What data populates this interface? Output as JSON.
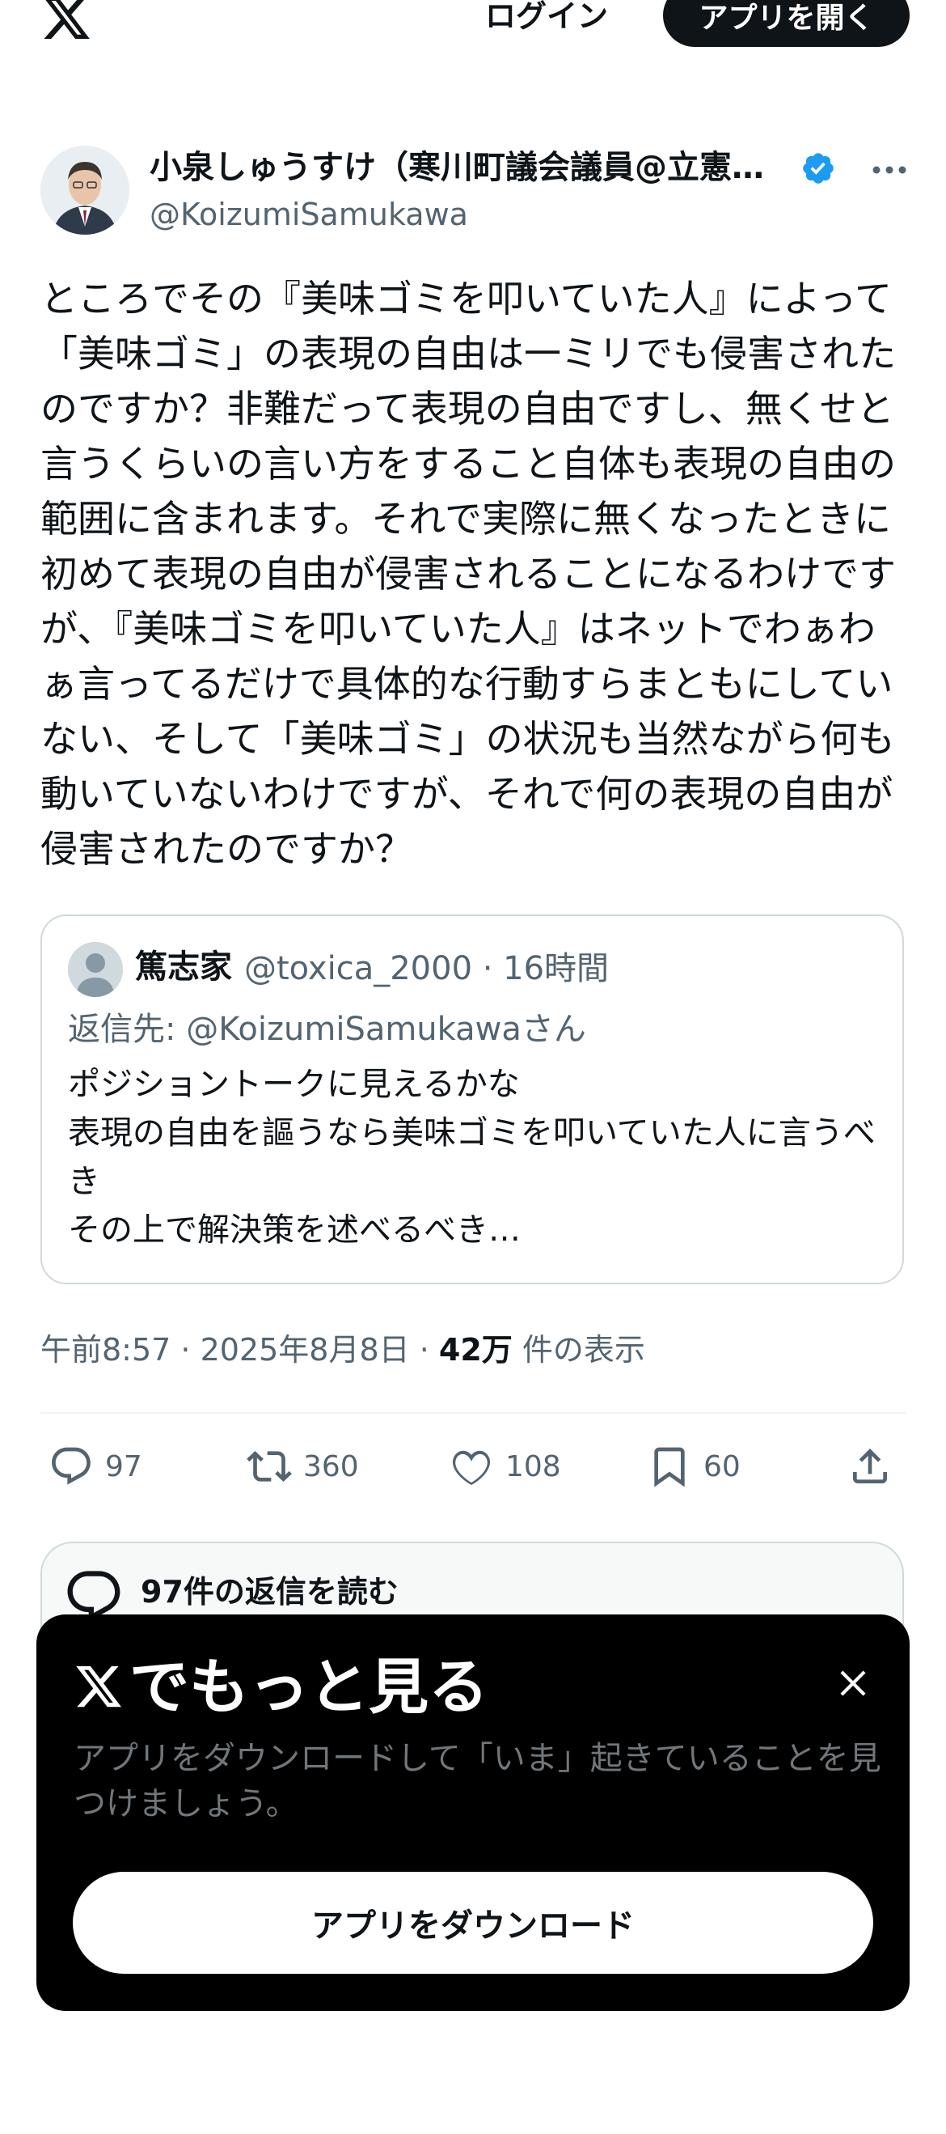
{
  "header": {
    "logo_icon": "x-logo-icon",
    "login_label": "ログイン",
    "open_app_label": "アプリを開く"
  },
  "tweet": {
    "author_name": "小泉しゅうすけ（寒川町議会議員@立憲…",
    "handle": "@KoizumiSamukawa",
    "verified_icon": "verified-badge-icon",
    "more_icon": "more-dots-icon",
    "text": "ところでその『美味ゴミを叩いていた人』によって「美味ゴミ」の表現の自由は一ミリでも侵害されたのですか？非難だって表現の自由ですし、無くせと言うくらいの言い方をすること自体も表現の自由の範囲に含まれます。それで実際に無くなったときに初めて表現の自由が侵害されることになるわけですが、『美味ゴミを叩いていた人』はネットでわぁわぁ言ってるだけで具体的な行動すらまともにしていない、そして「美味ゴミ」の状況も当然ながら何も動いていないわけですが、それで何の表現の自由が侵害されたのですか？",
    "quote": {
      "name": "篤志家",
      "meta": "@toxica_2000 · 16時間",
      "reply_to": "返信先: @KoizumiSamukawaさん",
      "text": "ポジショントークに見えるかな\n表現の自由を謳うなら美味ゴミを叩いていた人に言うべき\nその上で解決策を述べるべき…"
    },
    "timestamp": "午前8:57 · 2025年8月8日 · ",
    "views_count": "42万",
    "views_label": " 件の表示",
    "actions": {
      "replies": "97",
      "retweets": "360",
      "likes": "108",
      "bookmarks": "60"
    }
  },
  "read_replies_label": "97件の返信を読む",
  "modal": {
    "title": "でもっと見る",
    "description": "アプリをダウンロードして「いま」起きていることを見つけましょう。",
    "download_label": "アプリをダウンロード"
  },
  "colors": {
    "text": "#0f1419",
    "secondary": "#536471",
    "verified": "#1d9bf0",
    "border": "#cfd9de"
  }
}
